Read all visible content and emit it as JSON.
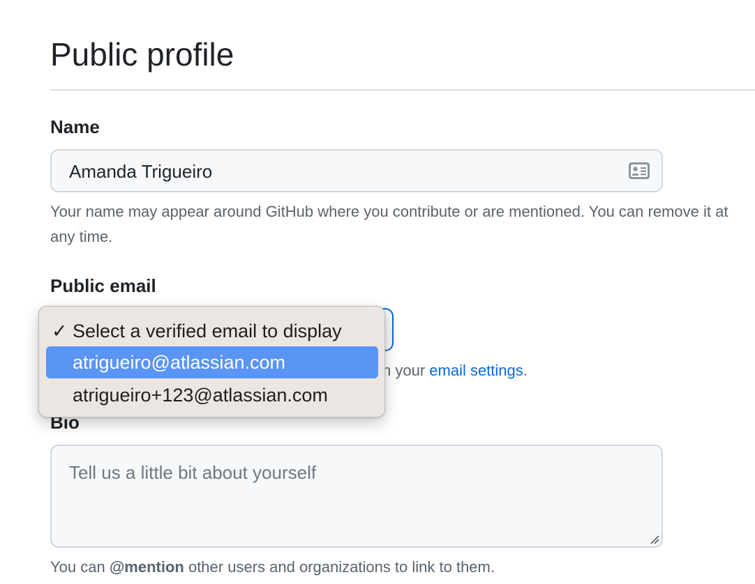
{
  "page": {
    "title": "Public profile"
  },
  "name_field": {
    "label": "Name",
    "value": "Amanda Trigueiro",
    "helper": "Your name may appear around GitHub where you contribute or are mentioned. You can remove it at any time."
  },
  "email_field": {
    "label": "Public email",
    "helper_prefix": "n your ",
    "helper_link": "email settings",
    "helper_suffix": ".",
    "options": [
      {
        "label": "Select a verified email to display",
        "checked": true,
        "highlighted": false
      },
      {
        "label": "atrigueiro@atlassian.com",
        "checked": false,
        "highlighted": true
      },
      {
        "label": "atrigueiro+123@atlassian.com",
        "checked": false,
        "highlighted": false
      }
    ],
    "check_glyph": "✓"
  },
  "bio_field": {
    "label": "Bio",
    "placeholder": "Tell us a little bit about yourself",
    "helper_prefix": "You can ",
    "helper_bold": "@mention",
    "helper_suffix": " other users and organizations to link to them."
  },
  "colors": {
    "accent": "#0969da",
    "highlight": "#5a94f5",
    "menu_background": "#ebe6e2"
  },
  "icons": {
    "name_field_icon": "contact-card-icon",
    "textarea_resize": "resize-handle-icon",
    "checked_option": "checkmark-icon"
  }
}
